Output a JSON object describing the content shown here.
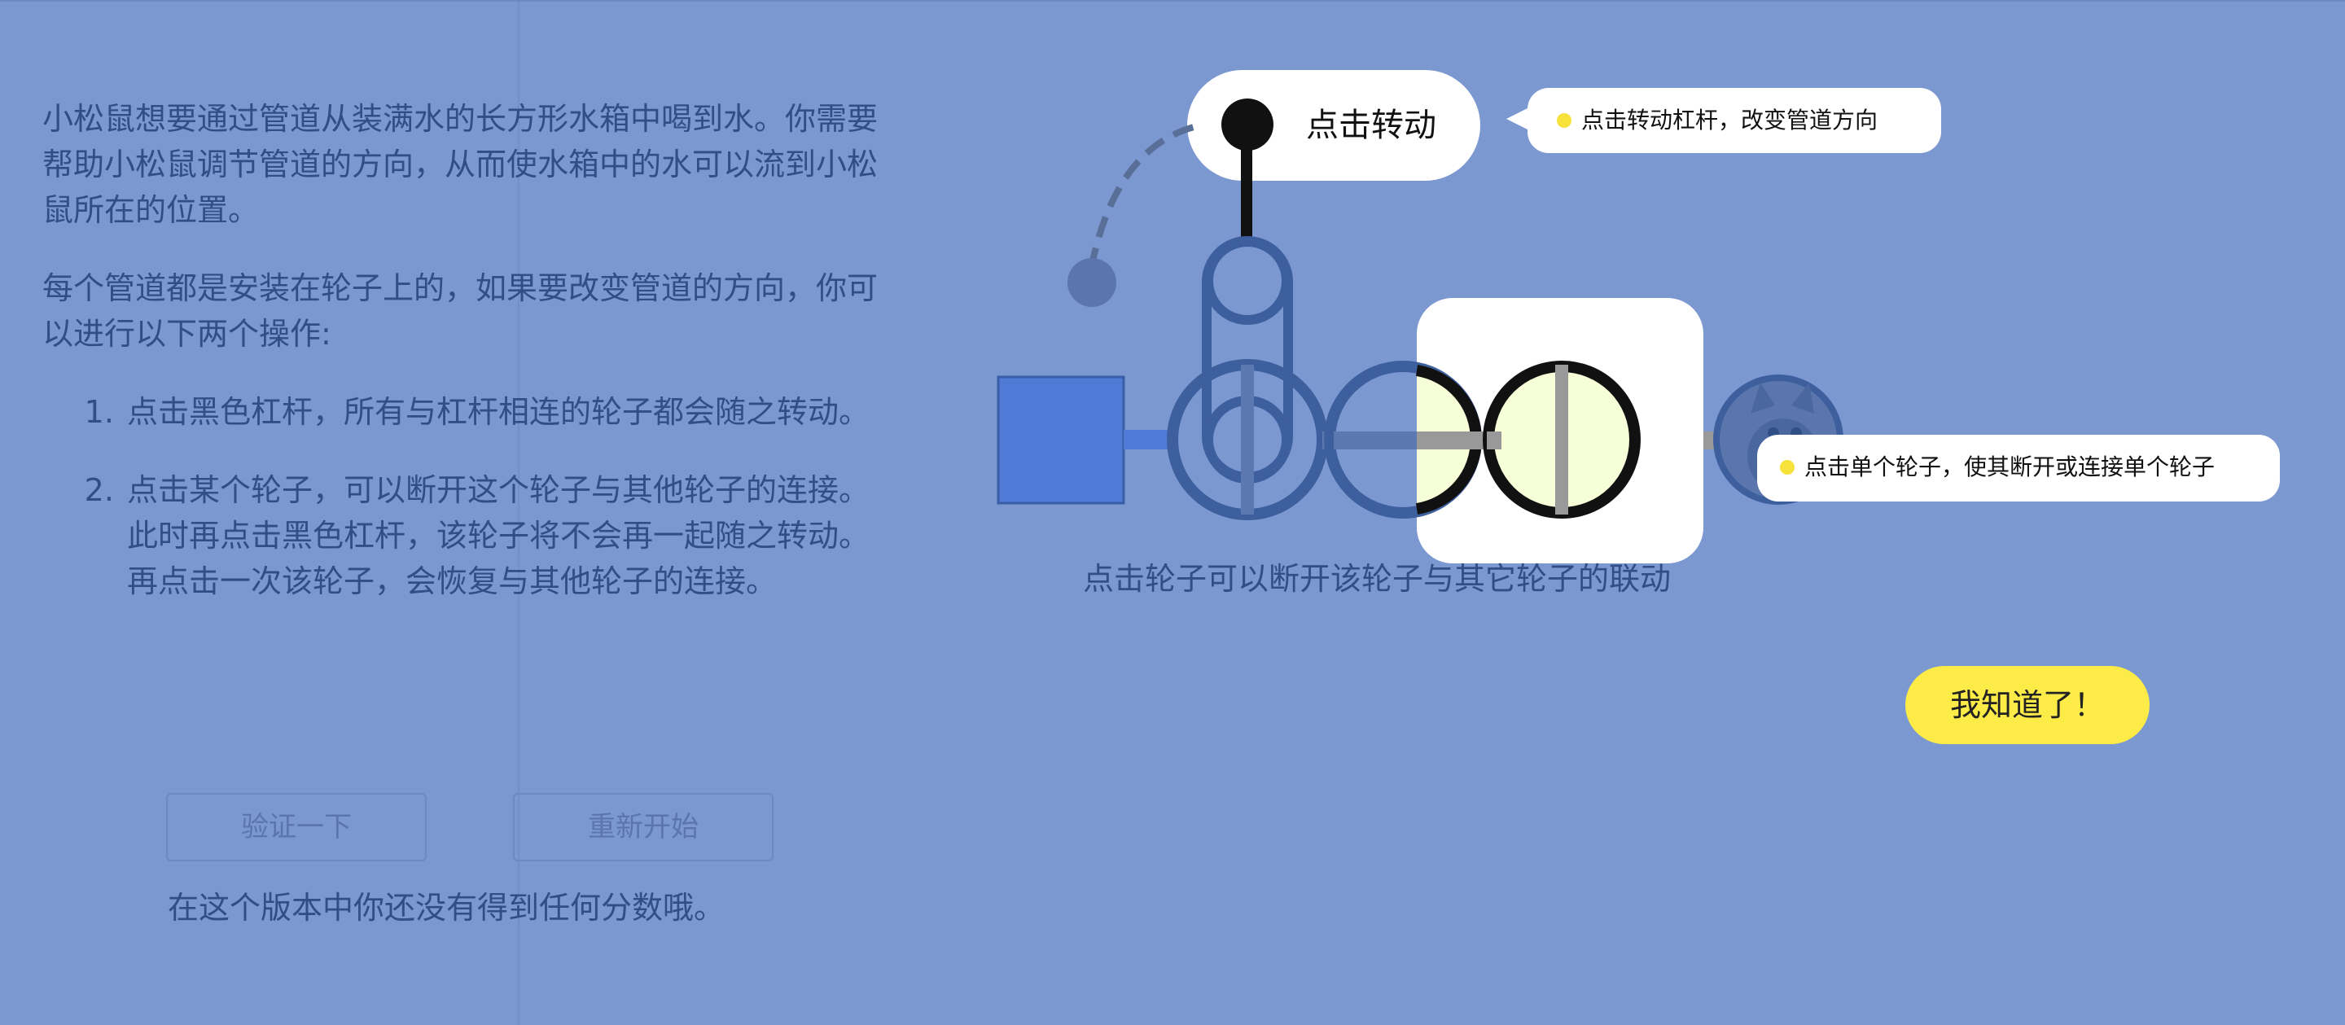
{
  "instructions": {
    "intro": "小松鼠想要通过管道从装满水的长方形水箱中喝到水。你需要帮助小松鼠调节管道的方向，从而使水箱中的水可以流到小松鼠所在的位置。",
    "lead": "每个管道都是安装在轮子上的，如果要改变管道的方向，你可以进行以下两个操作:",
    "steps": [
      "点击黑色杠杆，所有与杠杆相连的轮子都会随之转动。",
      "点击某个轮子，可以断开这个轮子与其他轮子的连接。此时再点击黑色杠杆，该轮子将不会再一起随之转动。再点击一次该轮子，会恢复与其他轮子的连接。"
    ]
  },
  "buttons": {
    "verify": "验证一下",
    "restart": "重新开始",
    "got_it": "我知道了！"
  },
  "score_note": "在这个版本中你还没有得到任何分数哦。",
  "tutorial": {
    "lever_label": "点击转动",
    "tip_lever": "点击转动杠杆，改变管道方向",
    "tip_wheel": "点击单个轮子，使其断开或连接单个轮子",
    "caption": "点击轮子可以断开该轮子与其它轮子的联动"
  },
  "icons": [
    "lever-handle-icon",
    "water-tank-icon",
    "wheel-icon",
    "squirrel-icon",
    "tip-dot-icon"
  ],
  "colors": {
    "overlay_background": "#7b98d1",
    "tank_blue": "#4f7ad6",
    "wheel_outline_dim": "#3e5f9e",
    "wheel_highlight_fill": "#f7ffd9",
    "accent_yellow": "#fdec48"
  }
}
